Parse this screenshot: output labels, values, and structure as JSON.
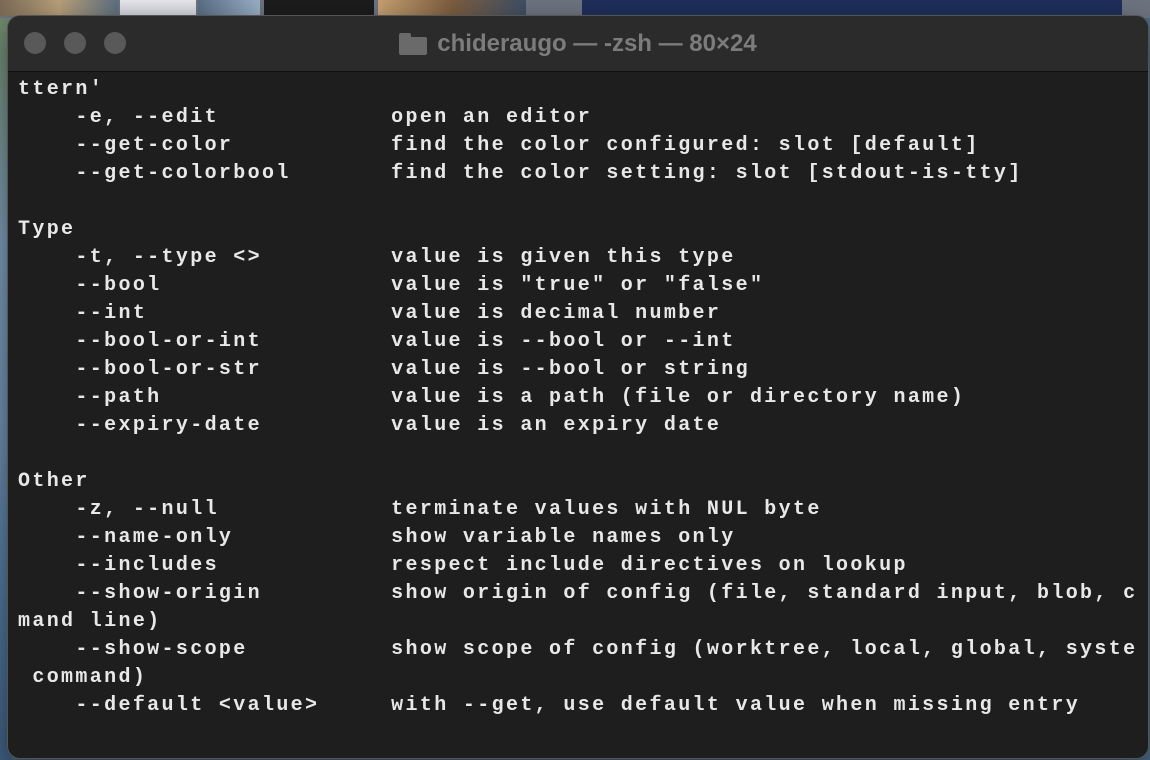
{
  "window": {
    "title": "chideraugo — -zsh — 80×24"
  },
  "terminal": {
    "lines": [
      "ttern'",
      "    -e, --edit            open an editor",
      "    --get-color           find the color configured: slot [default]",
      "    --get-colorbool       find the color setting: slot [stdout-is-tty]",
      "",
      "Type",
      "    -t, --type <>         value is given this type",
      "    --bool                value is \"true\" or \"false\"",
      "    --int                 value is decimal number",
      "    --bool-or-int         value is --bool or --int",
      "    --bool-or-str         value is --bool or string",
      "    --path                value is a path (file or directory name)",
      "    --expiry-date         value is an expiry date",
      "",
      "Other",
      "    -z, --null            terminate values with NUL byte",
      "    --name-only           show variable names only",
      "    --includes            respect include directives on lookup",
      "    --show-origin         show origin of config (file, standard input, blob, com",
      "mand line)",
      "    --show-scope          show scope of config (worktree, local, global, system,",
      " command)",
      "    --default <value>     with --get, use default value when missing entry"
    ]
  },
  "colors": {
    "background": "#1e1e1e",
    "text": "#e8e8e8",
    "titlebar": "#2b2b2b"
  },
  "icons": {
    "title": "folder-icon"
  }
}
